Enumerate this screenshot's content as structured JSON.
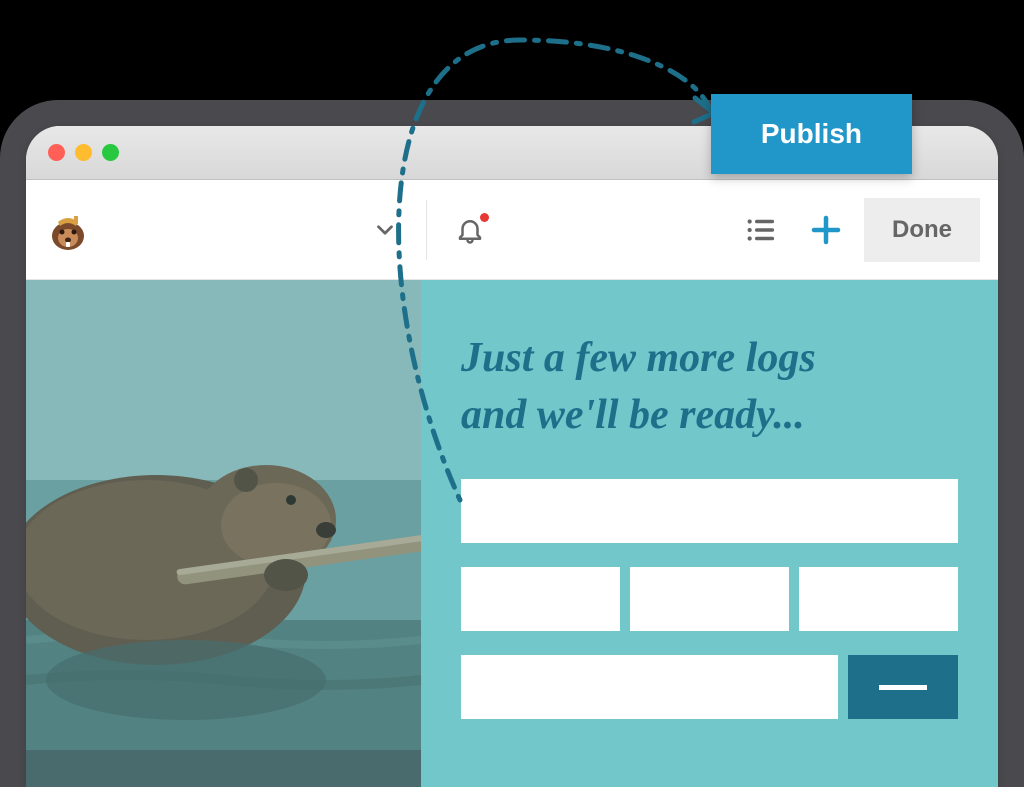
{
  "publish_button": {
    "label": "Publish"
  },
  "toolbar": {
    "done_label": "Done"
  },
  "hero": {
    "headline_line1": "Just a few more logs",
    "headline_line2": "and we'll be ready..."
  },
  "icons": {
    "logo": "beaver-logo",
    "chevron": "chevron-down-icon",
    "bell": "bell-icon",
    "list": "list-icon",
    "plus": "plus-icon"
  },
  "colors": {
    "accent": "#2196c9",
    "panel": "#72c7ca",
    "headline": "#1e6f8a",
    "submit": "#1e6f8a"
  }
}
